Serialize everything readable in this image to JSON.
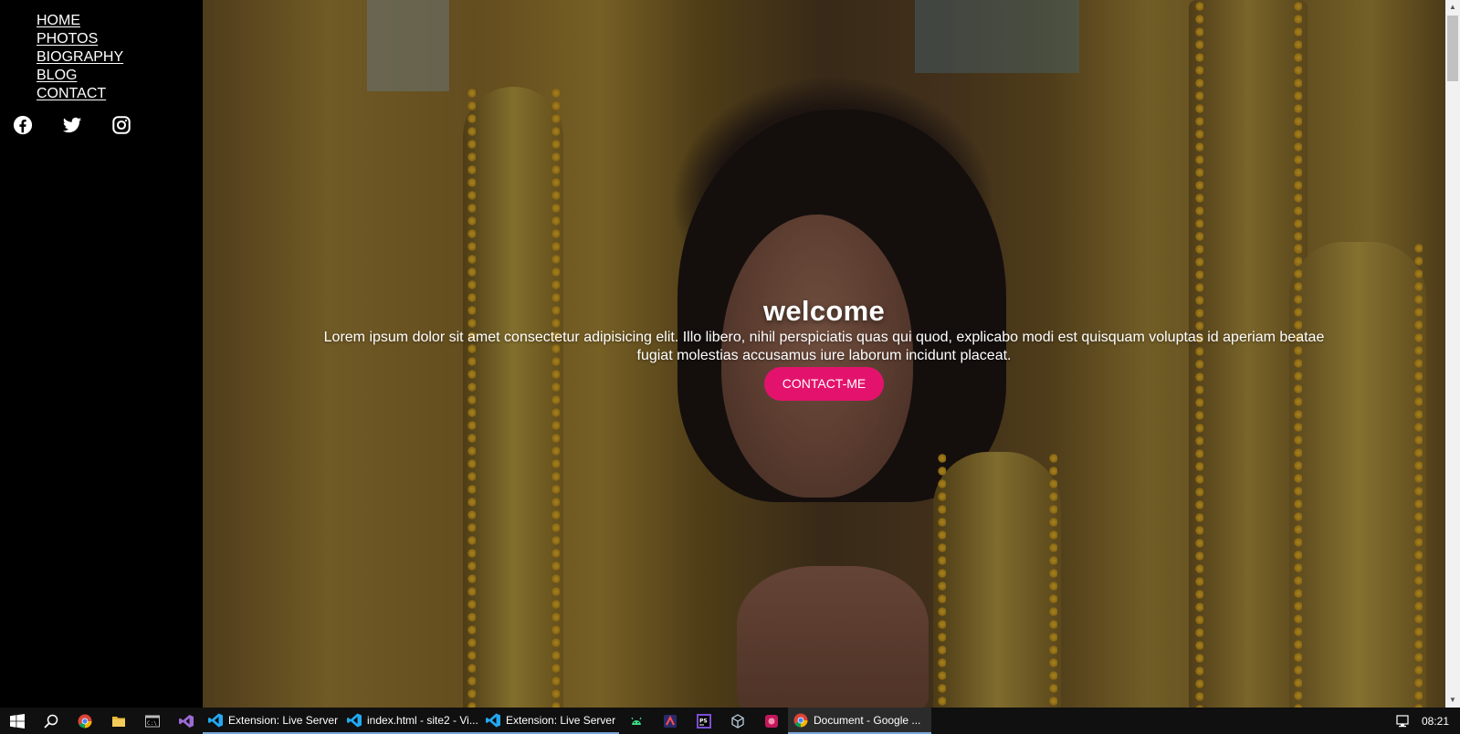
{
  "sidebar": {
    "nav": [
      "HOME",
      "PHOTOS",
      "BIOGRAPHY",
      "BLOG",
      "CONTACT"
    ],
    "social": [
      "facebook-icon",
      "twitter-icon",
      "instagram-icon"
    ]
  },
  "hero": {
    "title": "welcome",
    "text": "Lorem ipsum dolor sit amet consectetur adipisicing elit. Illo libero, nihil perspiciatis quas qui quod, explicabo modi est quisquam voluptas id aperiam beatae fugiat molestias accusamus iure laborum incidunt placeat.",
    "button": "CONTACT-ME",
    "button_color": "#e3136d"
  },
  "taskbar": {
    "apps": [
      "Extension: Live Server ...",
      "index.html - site2 - Vi...",
      "Extension: Live Server ...",
      "Document - Google ..."
    ],
    "clock": "08:21"
  }
}
